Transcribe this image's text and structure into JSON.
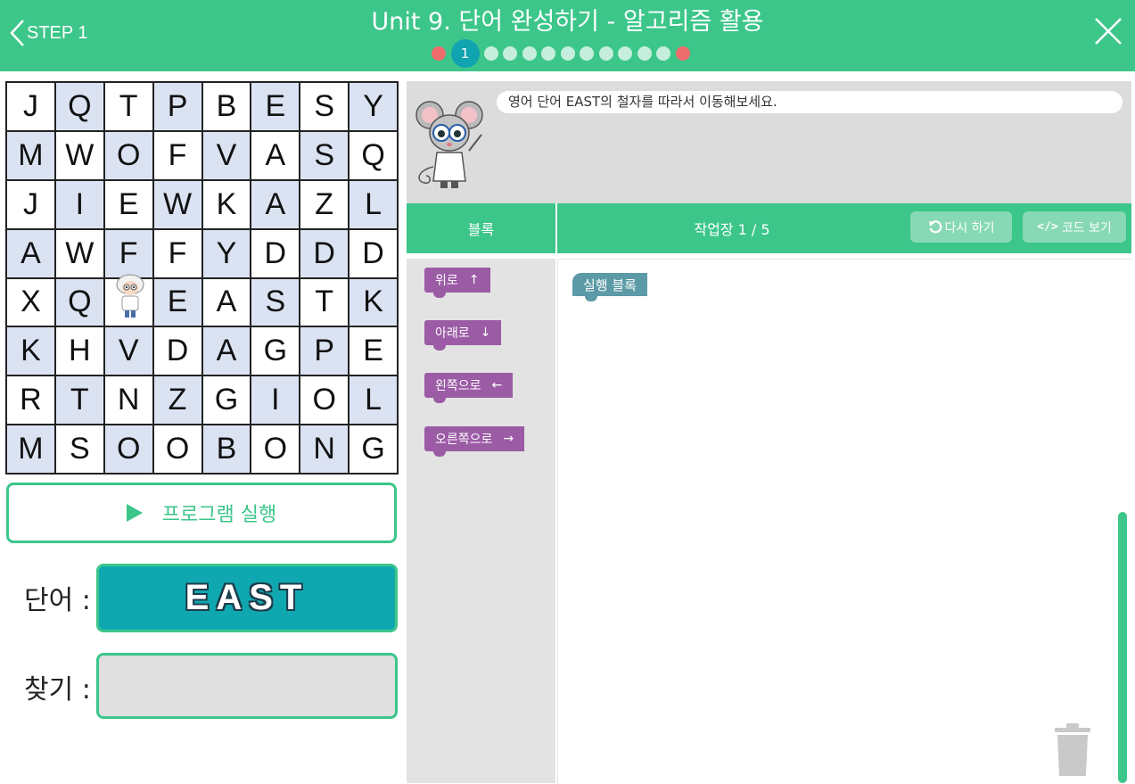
{
  "header": {
    "back_label": "STEP 1",
    "title": "Unit 9. 단어 완성하기 - 알고리즘 활용",
    "current_step": "1",
    "progress_dots": [
      "red",
      "current",
      "grey",
      "grey",
      "grey",
      "grey",
      "grey",
      "grey",
      "grey",
      "grey",
      "grey",
      "grey",
      "red"
    ]
  },
  "grid": [
    [
      "J",
      "Q",
      "T",
      "P",
      "B",
      "E",
      "S",
      "Y"
    ],
    [
      "M",
      "W",
      "O",
      "F",
      "V",
      "A",
      "S",
      "Q"
    ],
    [
      "J",
      "I",
      "E",
      "W",
      "K",
      "A",
      "Z",
      "L"
    ],
    [
      "A",
      "W",
      "F",
      "F",
      "Y",
      "D",
      "D",
      "D"
    ],
    [
      "X",
      "Q",
      "",
      "E",
      "A",
      "S",
      "T",
      "K"
    ],
    [
      "K",
      "H",
      "V",
      "D",
      "A",
      "G",
      "P",
      "E"
    ],
    [
      "R",
      "T",
      "N",
      "Z",
      "G",
      "I",
      "O",
      "L"
    ],
    [
      "M",
      "S",
      "O",
      "O",
      "B",
      "O",
      "N",
      "G"
    ]
  ],
  "run_program_label": "프로그램 실행",
  "word_label": "단어 :",
  "word_value": "EAST",
  "find_label": "찾기 :",
  "find_value": "",
  "mission_text": "영어 단어 EAST의 철자를 따라서 이동해보세요.",
  "toolbar": {
    "blocks_tab": "블록",
    "workspace_title": "작업장  1 / 5",
    "reset_label": "다시 하기",
    "code_label": "코드 보기"
  },
  "palette_blocks": [
    {
      "label": "위로",
      "arrow": "↑"
    },
    {
      "label": "아래로",
      "arrow": "↓"
    },
    {
      "label": "왼쪽으로",
      "arrow": "←"
    },
    {
      "label": "오른쪽으로",
      "arrow": "→"
    }
  ],
  "run_block_label": "실행 블록",
  "colors": {
    "accent": "#3cc68a",
    "word_box": "#10a8b0",
    "move_block": "#9b5ba5",
    "run_block": "#5b9aa6",
    "grid_shade": "#dbe3f3",
    "dot_red": "#ee6c6c"
  }
}
